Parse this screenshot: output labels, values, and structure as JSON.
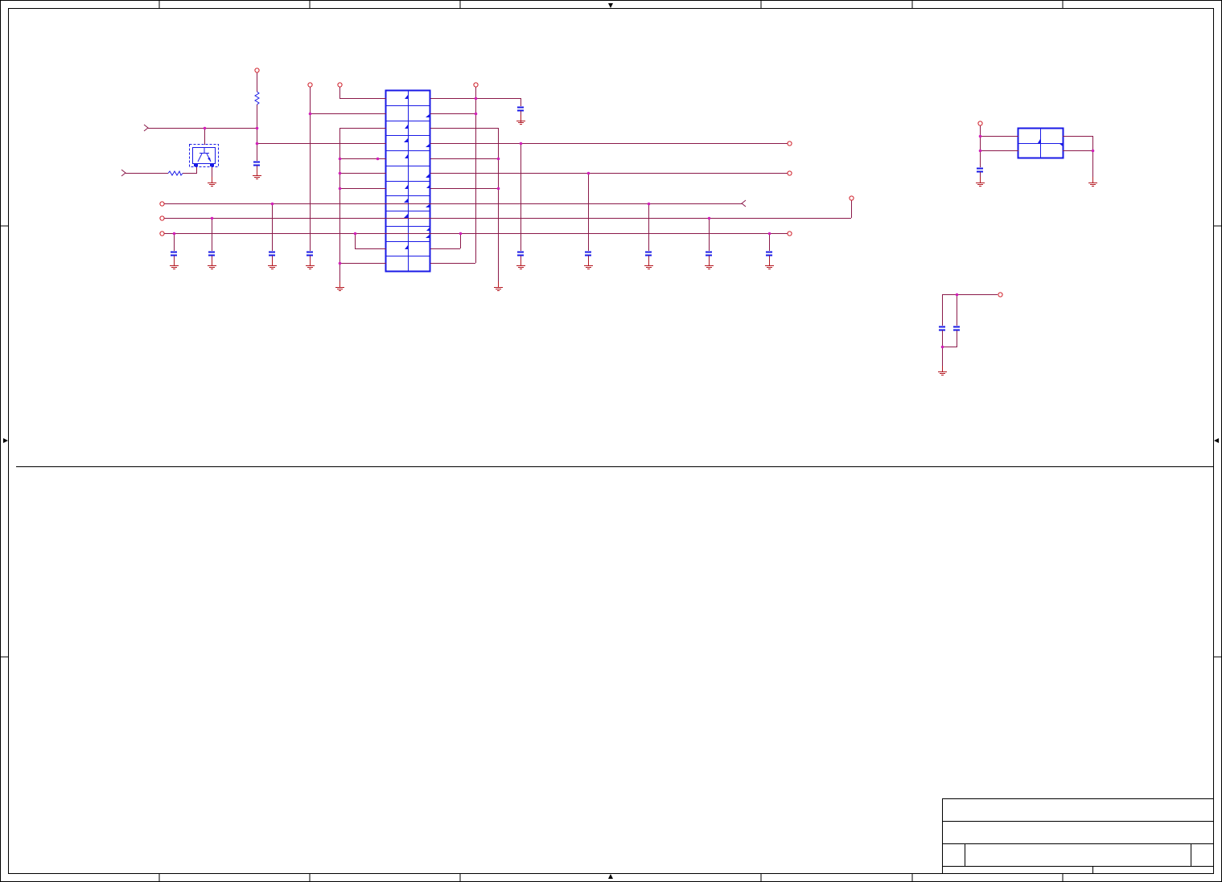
{
  "sheet": {
    "colors": {
      "wire": "#8b1a4a",
      "ground": "#b3161f",
      "part": "#1a1ae6",
      "junction": "#d21fb9",
      "terminal": "#d0202a",
      "frame": "#000000"
    },
    "icons": [
      "ground-icon",
      "capacitor-icon",
      "resistor-icon",
      "transistor-icon",
      "connector-icon",
      "terminal-icon",
      "junction-dot-icon",
      "zone-arrow-icon"
    ]
  },
  "title_block": {
    "title": "",
    "subtitle": "",
    "size": "",
    "document_number": "",
    "revision": "",
    "date": "",
    "sheet_of": ""
  }
}
